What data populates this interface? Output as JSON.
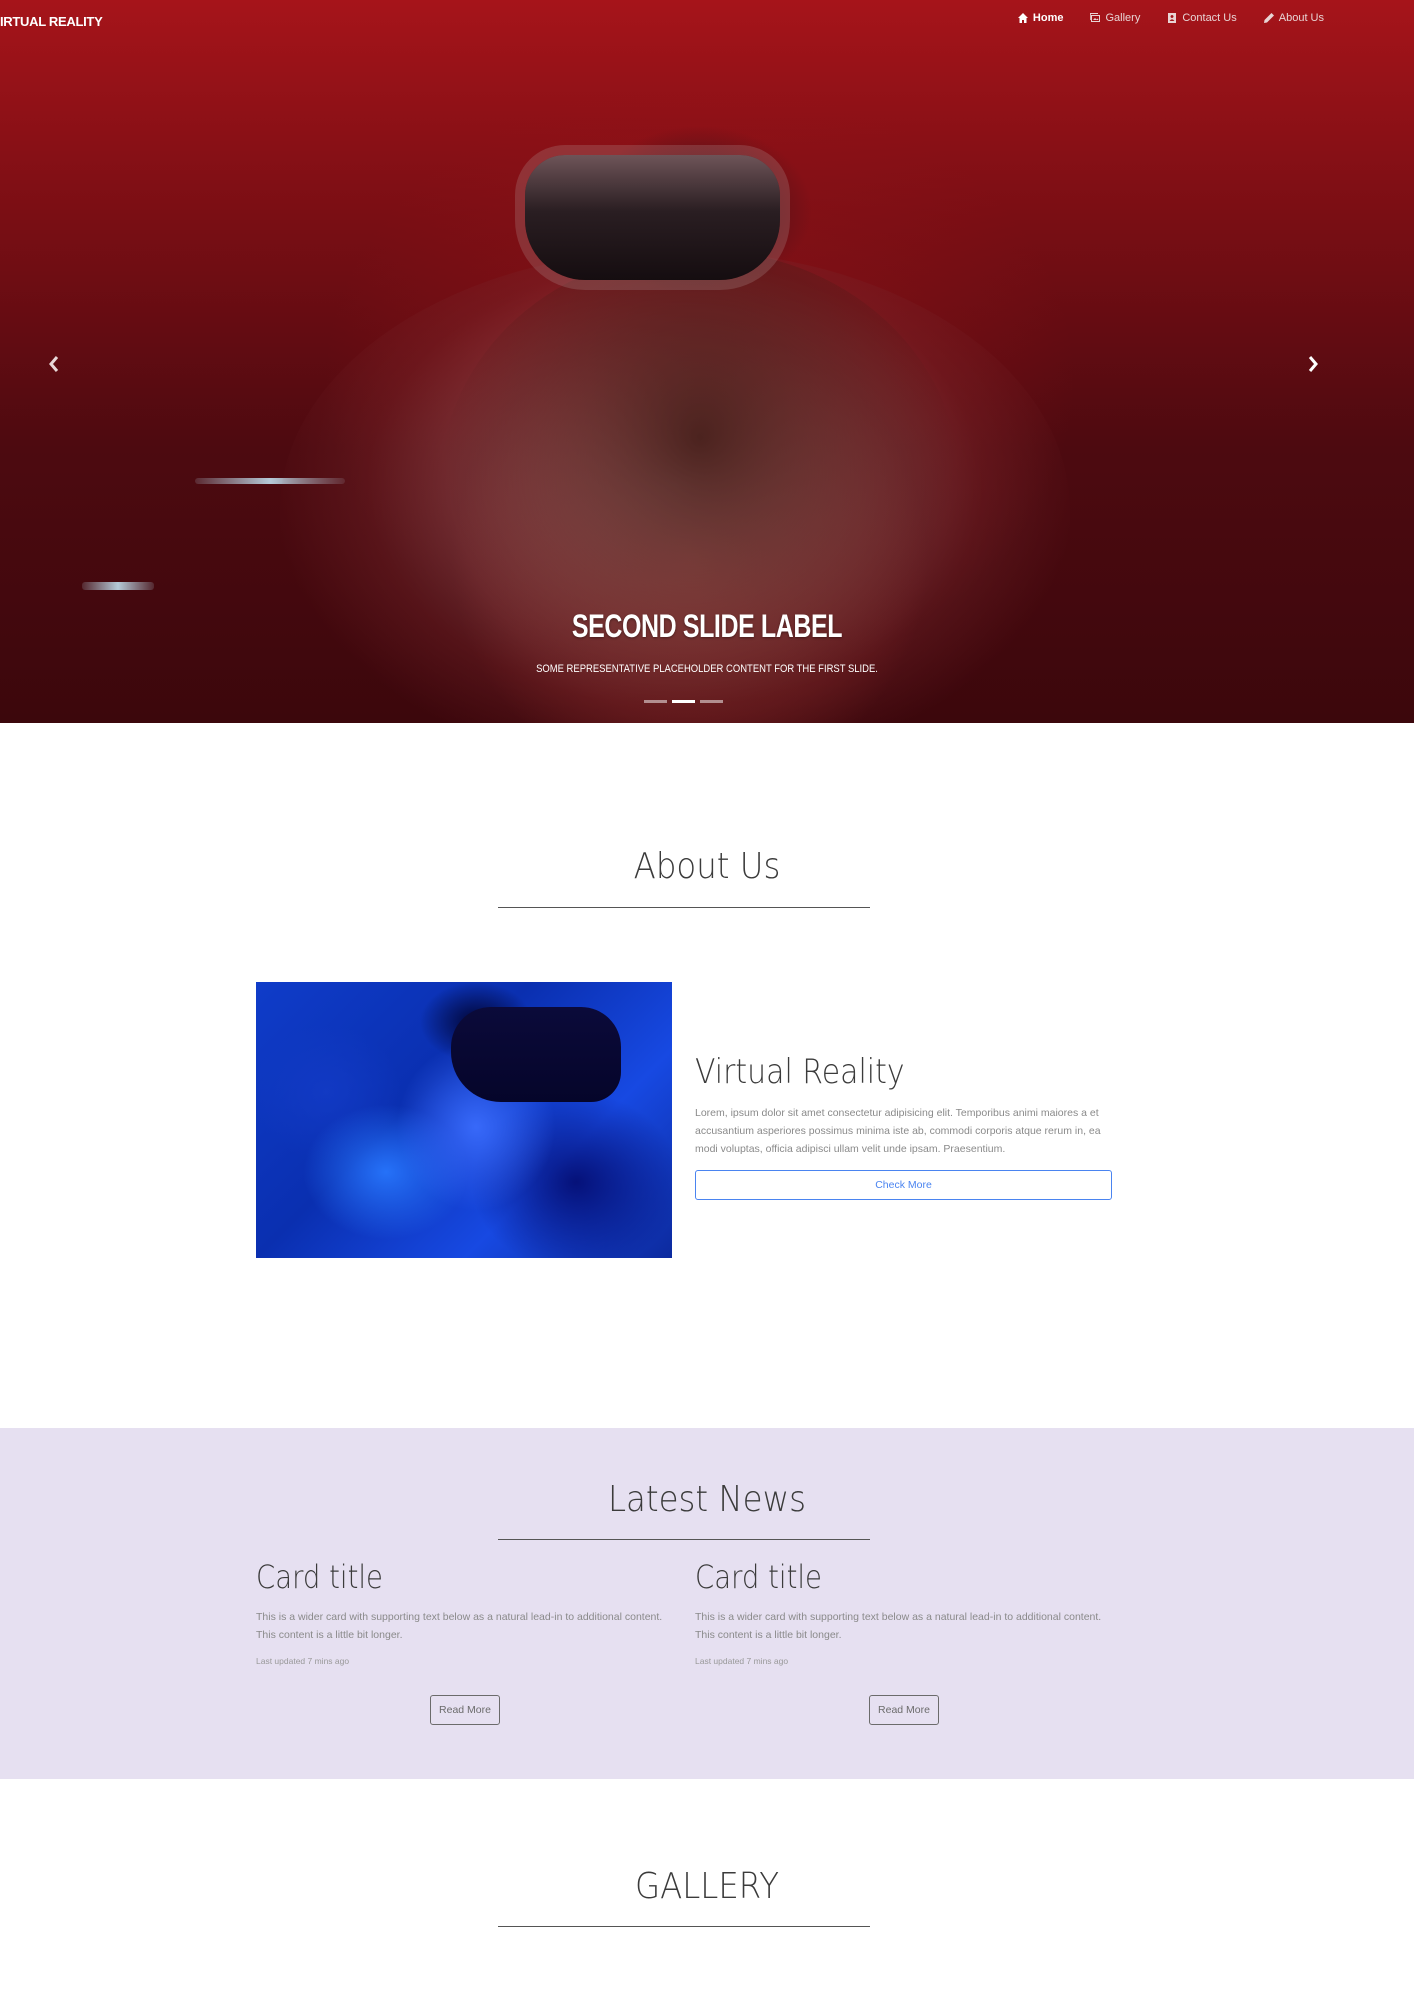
{
  "navbar": {
    "brand": "IRTUAL REALITY",
    "links": [
      {
        "label": "Home",
        "icon": "home-icon",
        "active": true
      },
      {
        "label": "Gallery",
        "icon": "image-icon",
        "active": false
      },
      {
        "label": "Contact Us",
        "icon": "address-book-icon",
        "active": false
      },
      {
        "label": "About Us",
        "icon": "pencil-icon",
        "active": false
      }
    ]
  },
  "hero": {
    "caption_title": "SECOND SLIDE LABEL",
    "caption_text": "Some representative placeholder content for the first slide.",
    "slides_count": 3,
    "active_slide": 2,
    "prev_icon": "chevron-left-icon",
    "next_icon": "chevron-right-icon"
  },
  "about": {
    "heading": "About Us",
    "title": "Virtual Reality",
    "text": "Lorem, ipsum dolor sit amet consectetur adipisicing elit. Temporibus animi maiores a et accusantium asperiores possimus minima iste ab, commodi corporis atque rerum in, ea modi voluptas, officia adipisci ullam velit unde ipsam. Praesentium.",
    "button_label": "Check More",
    "button_color": "#4a84f0"
  },
  "news": {
    "heading": "Latest News",
    "background": "#e6e0f1",
    "cards": [
      {
        "title": "Card title",
        "text": "This is a wider card with supporting text below as a natural lead-in to additional content. This content is a little bit longer.",
        "meta": "Last updated 7 mins ago",
        "button_label": "Read More"
      },
      {
        "title": "Card title",
        "text": "This is a wider card with supporting text below as a natural lead-in to additional content. This content is a little bit longer.",
        "meta": "Last updated 7 mins ago",
        "button_label": "Read More"
      }
    ]
  },
  "gallery": {
    "heading": "GALLERY"
  }
}
